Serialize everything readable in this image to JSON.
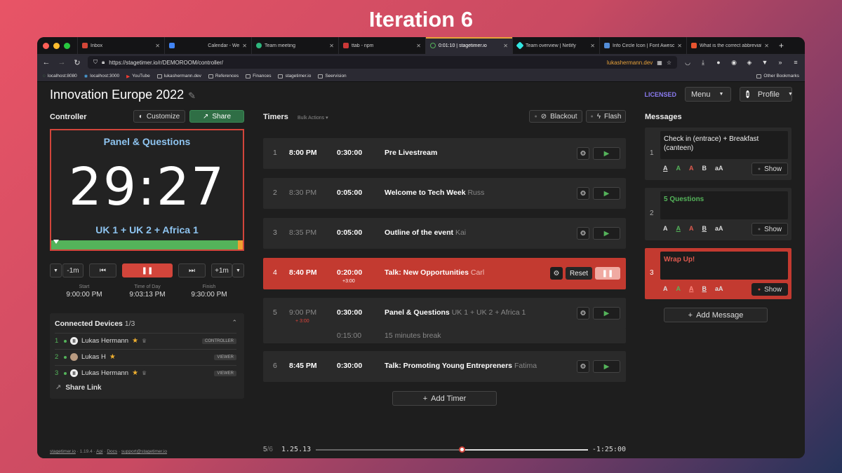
{
  "banner": "Iteration 6",
  "browser": {
    "tabs": [
      {
        "label": "Inbox",
        "color": "#d44638"
      },
      {
        "label": "",
        "color": "#4285f4"
      },
      {
        "label": "Calendar - We",
        "color": "#4285f4"
      },
      {
        "label": "Team meeting",
        "color": "#2eb67d"
      },
      {
        "label": "ttab - npm",
        "color": "#cb3837"
      },
      {
        "label": "0:01:10 | stagetimer.io",
        "color": "#54b35a"
      },
      {
        "label": "Team overview | Netlify",
        "color": "#32e6e2"
      },
      {
        "label": "Info Circle Icon | Font Awesome",
        "color": "#538dd7"
      },
      {
        "label": "What is the correct abbreviati",
        "color": "#e8542f"
      }
    ],
    "url": "https://stagetimer.io/r/DEMOROOM/controller/",
    "url_domain": "lukashermann.dev",
    "bookmarks": [
      "localhost:8080",
      "localhost:3000",
      "YouTube",
      "lukashermann.dev",
      "References",
      "Finances",
      "stagetimer.io",
      "Seervision"
    ],
    "other_bookmarks": "Other Bookmarks"
  },
  "app": {
    "title": "Innovation Europe 2022",
    "licensed": "LICENSED",
    "menu": "Menu",
    "profile": "Profile",
    "controller_label": "Controller",
    "customize": "Customize",
    "share": "Share",
    "preview": {
      "title": "Panel & Questions",
      "time": "29:27",
      "subtitle": "UK 1 + UK 2 + Africa 1",
      "progress": 0.98
    },
    "controls": {
      "minus": "-1m",
      "plus": "+1m"
    },
    "times": [
      {
        "label": "Start",
        "value": "9:00:00 PM"
      },
      {
        "label": "Time of Day",
        "value": "9:03:13 PM"
      },
      {
        "label": "Finish",
        "value": "9:30:00 PM"
      }
    ],
    "devices": {
      "title": "Connected Devices",
      "count": "1/3",
      "share_link": "Share Link",
      "rows": [
        {
          "num": "1",
          "name": "Lukas Hermann",
          "role": "CONTROLLER"
        },
        {
          "num": "2",
          "name": "Lukas H",
          "role": "VIEWER"
        },
        {
          "num": "3",
          "name": "Lukas Hermann",
          "role": "VIEWER"
        }
      ]
    },
    "footer": {
      "site": "stagetimer.io",
      "version": "1.19.4",
      "api": "Api",
      "docs": "Docs",
      "support": "support@stagetimer.io"
    }
  },
  "timers": {
    "label": "Timers",
    "bulk": "Bulk Actions",
    "blackout": "Blackout",
    "flash": "Flash",
    "add": "Add Timer",
    "rows": [
      {
        "num": "1",
        "start": "8:00 PM",
        "duration": "0:30:00",
        "name": "Pre Livestream",
        "speaker": "",
        "dim": false,
        "note": ""
      },
      {
        "num": "2",
        "start": "8:30 PM",
        "duration": "0:05:00",
        "name": "Welcome to Tech Week",
        "speaker": "Russ",
        "dim": true,
        "note": ""
      },
      {
        "num": "3",
        "start": "8:35 PM",
        "duration": "0:05:00",
        "name": "Outline of the event",
        "speaker": "Kai",
        "dim": true,
        "note": ""
      },
      {
        "num": "4",
        "start": "8:40 PM",
        "duration": "0:20:00",
        "name": "Talk: New Opportunities",
        "speaker": "Carl",
        "dim": false,
        "note": "+3:00"
      },
      {
        "num": "5",
        "start": "9:00 PM",
        "duration": "0:30:00",
        "name": "Panel & Questions",
        "speaker": "UK 1 + UK 2 + Africa 1",
        "dim": true,
        "note": "+ 3:00"
      },
      {
        "num": "",
        "start": "",
        "duration": "0:15:00",
        "name": "15 minutes break",
        "speaker": "",
        "dim": true,
        "note": ""
      },
      {
        "num": "6",
        "start": "8:45 PM",
        "duration": "0:30:00",
        "name": "Talk: Promoting Young Entrepreners",
        "speaker": "Fatima",
        "dim": false,
        "note": ""
      }
    ],
    "reset": "Reset",
    "bottom": {
      "index": "5",
      "total": "/6",
      "elapsed": "1.25.13",
      "remaining": "-1:25:00",
      "progress": 0.5
    }
  },
  "messages": {
    "label": "Messages",
    "add": "Add Message",
    "show": "Show",
    "tools": [
      "A",
      "A",
      "A",
      "B",
      "aA"
    ],
    "rows": [
      {
        "num": "1",
        "text": "Check in (entrace) + Breakfast (canteen)",
        "color": "#eeeeee"
      },
      {
        "num": "2",
        "text": "5 Questions",
        "color": "#54b35a"
      },
      {
        "num": "3",
        "text": "Wrap Up!",
        "color": "#e05a4f"
      }
    ]
  }
}
